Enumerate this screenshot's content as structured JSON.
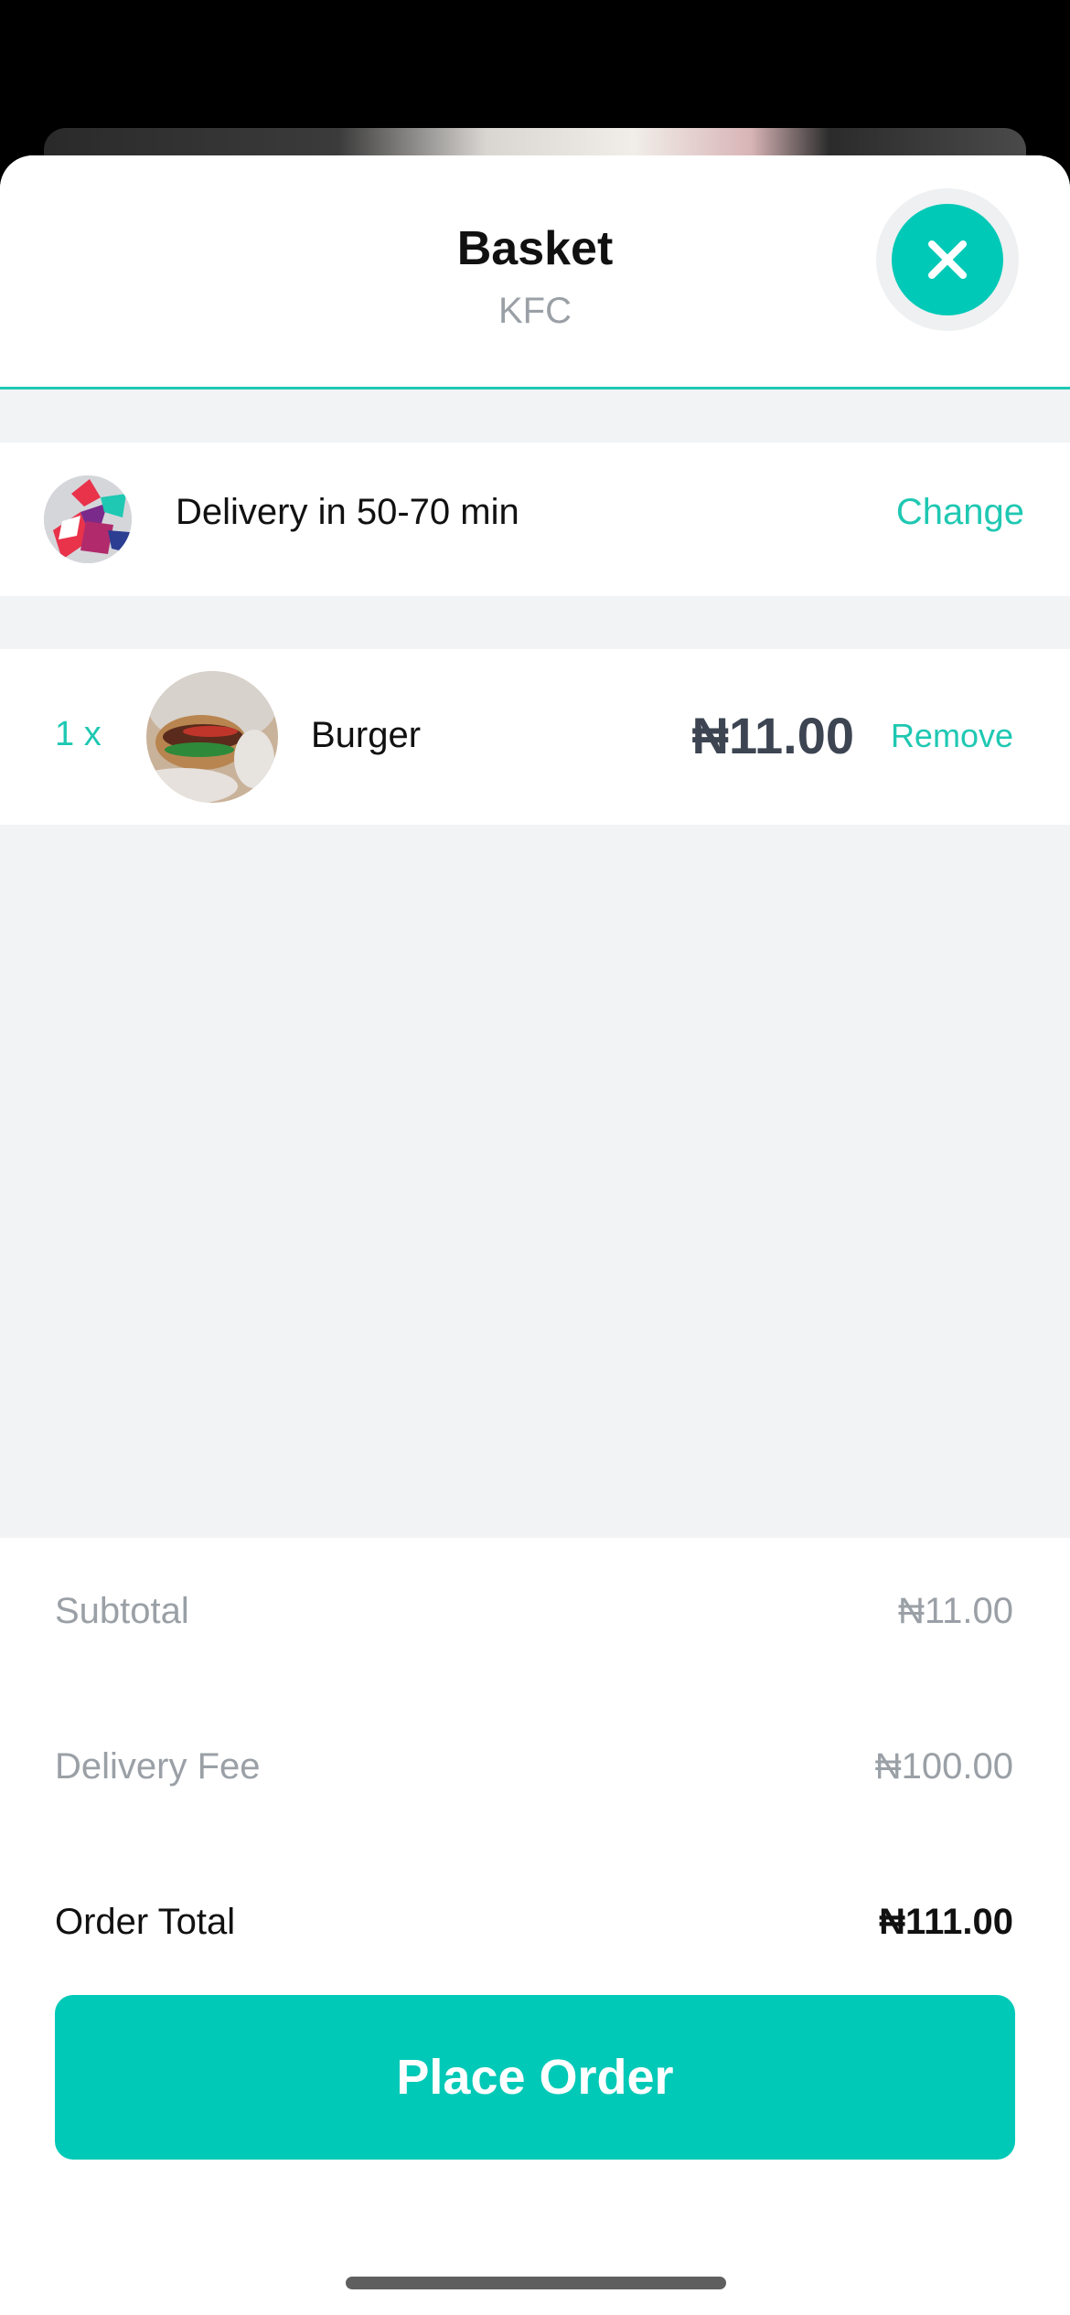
{
  "header": {
    "title": "Basket",
    "subtitle": "KFC"
  },
  "delivery": {
    "text": "Delivery in 50-70 min",
    "change_label": "Change"
  },
  "items": [
    {
      "quantity": "1 x",
      "name": "Burger",
      "price": "₦11.00",
      "remove_label": "Remove"
    }
  ],
  "summary": {
    "subtotal_label": "Subtotal",
    "subtotal_value": "₦11.00",
    "delivery_fee_label": "Delivery Fee",
    "delivery_fee_value": "₦100.00",
    "order_total_label": "Order Total",
    "order_total_value": "₦111.00"
  },
  "actions": {
    "place_order_label": "Place Order"
  },
  "colors": {
    "accent": "#00C9B7",
    "price_text": "#3D4552",
    "muted_text": "#9AA0A6",
    "section_background": "#F2F3F5"
  },
  "icons": {
    "close": "close-icon"
  }
}
